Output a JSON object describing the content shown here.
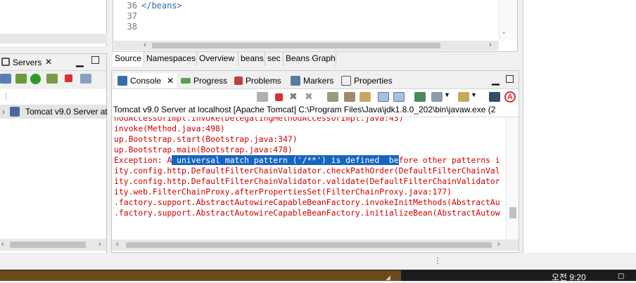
{
  "editor": {
    "lines": [
      {
        "num": "36",
        "code": "</beans>"
      },
      {
        "num": "37",
        "code": ""
      },
      {
        "num": "38",
        "code": ""
      }
    ],
    "tabs": [
      "Source",
      "Namespaces",
      "Overview",
      "beans",
      "sec",
      "Beans Graph"
    ],
    "active_tab": "Source"
  },
  "servers": {
    "tab_label": "Servers",
    "tree_item": "Tomcat v9.0 Server at"
  },
  "console": {
    "tabs": [
      "Console",
      "Progress",
      "Problems",
      "Markers",
      "Properties"
    ],
    "active_tab": "Console",
    "description": "Tomcat v9.0 Server at localhost [Apache Tomcat] C:\\Program Files\\Java\\jdk1.8.0_202\\bin\\javaw.exe  (2",
    "output_lines": [
      "hodAccessorImpl.invoke(DelegatingMethodAccessorImpl.java:43)",
      "invoke(Method.java:498)",
      "up.Bootstrap.start(Bootstrap.java:347)",
      "up.Bootstrap.main(Bootstrap.java:478)",
      "ity.config.http.DefaultFilterChainValidator.checkPathOrder(DefaultFilterChainVal",
      "ity.config.http.DefaultFilterChainValidator.validate(DefaultFilterChainValidator",
      "ity.web.FilterChainProxy.afterPropertiesSet(FilterChainProxy.java:177)",
      ".factory.support.AbstractAutowireCapableBeanFactory.invokeInitMethods(AbstractAu",
      ".factory.support.AbstractAutowireCapableBeanFactory.initializeBean(AbstractAutow"
    ],
    "exception_prefix": "Exception: A",
    "exception_selected": " universal match pattern ('/**') is defined  be",
    "exception_suffix": "fore other patterns i"
  },
  "taskbar": {
    "clock": "오전 9:20"
  },
  "colors": {
    "error_text": "#d00000",
    "selection": "#1565c0"
  }
}
